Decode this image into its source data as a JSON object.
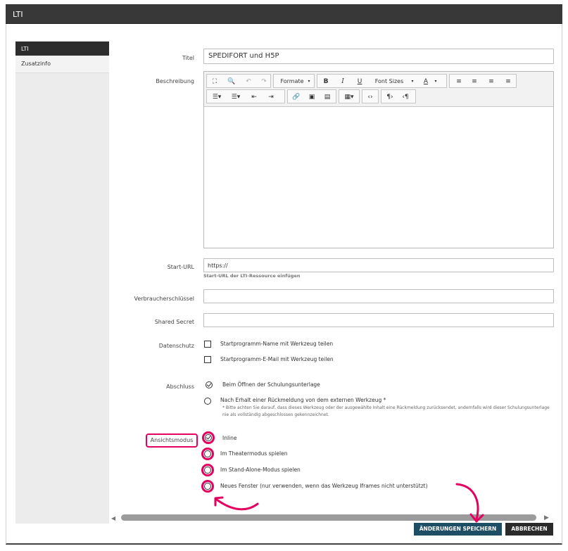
{
  "window": {
    "title": "LTI"
  },
  "sidebar": {
    "items": [
      {
        "label": "LTI"
      },
      {
        "label": "Zusatzinfo"
      }
    ]
  },
  "form": {
    "title_label": "Titel",
    "title_value": "SPEDIFORT und H5P",
    "description_label": "Beschreibung",
    "toolbar": {
      "formats": "Formate",
      "font_sizes": "Font Sizes",
      "bold": "B",
      "italic": "I",
      "underline": "U",
      "text_color": "A"
    },
    "start_url_label": "Start-URL",
    "start_url_value": "https://",
    "start_url_hint": "Start-URL der LTI-Ressource einfügen",
    "consumer_key_label": "Verbraucherschlüssel",
    "shared_secret_label": "Shared Secret",
    "privacy_label": "Datenschutz",
    "privacy_options": [
      "Startprogramm-Name mit Werkzeug teilen",
      "Startprogramm-E-Mail mit Werkzeug teilen"
    ],
    "completion_label": "Abschluss",
    "completion_options": [
      "Beim Öffnen der Schulungsunterlage",
      "Nach Erhalt einer Rückmeldung von dem externen Werkzeug *"
    ],
    "completion_note": "* Bitte achten Sie darauf, dass dieses Werkzeug oder der ausgewählte Inhalt eine Rückmeldung zurücksendet, andernfalls wird dieser Schulungsunterlage nie als vollständig abgeschlossen gekennzeichnet.",
    "view_mode_label": "Ansichtsmodus",
    "view_mode_options": [
      "Inline",
      "Im Theatermodus spielen",
      "Im Stand-Alone-Modus spielen",
      "Neues Fenster (nur verwenden, wenn das Werkzeug Iframes nicht unterstützt)"
    ]
  },
  "buttons": {
    "save": "ÄNDERUNGEN SPEICHERN",
    "cancel": "ABBRECHEN"
  },
  "colors": {
    "highlight": "#e3005f",
    "save_button": "#1e4e66",
    "titlebar": "#383838"
  }
}
